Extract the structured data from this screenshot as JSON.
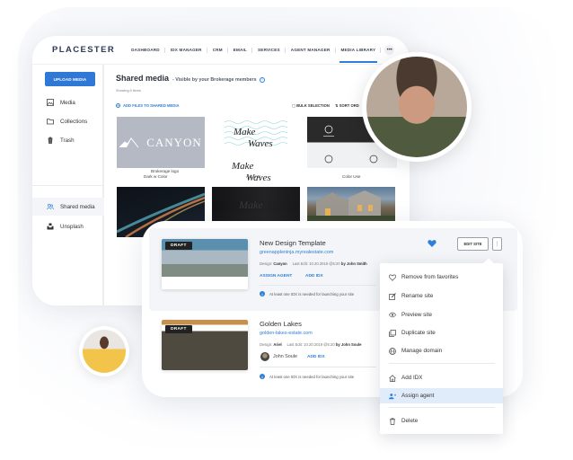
{
  "nav": {
    "brand": "PLACESTER",
    "items": [
      {
        "label": "DASHBOARD"
      },
      {
        "label": "IDX MANAGER"
      },
      {
        "label": "CRM"
      },
      {
        "label": "EMAIL"
      },
      {
        "label": "SERVICES"
      },
      {
        "label": "AGENT MANAGER"
      },
      {
        "label": "MEDIA LIBRARY",
        "active": true
      }
    ],
    "more": "•••"
  },
  "sidebar": {
    "upload_label": "UPLOAD MEDIA",
    "items": [
      {
        "label": "Media",
        "icon": "image-icon"
      },
      {
        "label": "Collections",
        "icon": "folder-icon"
      },
      {
        "label": "Trash",
        "icon": "trash-icon"
      },
      {
        "label": "Shared media",
        "icon": "users-icon",
        "active": true
      },
      {
        "label": "Unsplash",
        "icon": "unsplash-icon"
      }
    ]
  },
  "media": {
    "title": "Shared media",
    "subtitle": "- Visible by your Brokerage members",
    "help": "?",
    "showing": "Showing 6 items",
    "add_files": "ADD FILES TO SHARED MEDIA",
    "bulk": "BULK SELECTION",
    "sort": "SORT ORD",
    "thumbs": [
      {
        "logo_text": "CANYON",
        "caption1": "Brokerage logo",
        "caption2": "Dark w Color"
      },
      {
        "logo_text": "Make Waves",
        "caption": "Accents"
      },
      {
        "caption": "Color Use"
      }
    ]
  },
  "sites": [
    {
      "badge": "DRAFT",
      "name": "New Design Template",
      "url": "greenappleninja.myrealestate.com",
      "design_label": "Design:",
      "design": "Canyon",
      "last_edit_label": "Last Edit: 10.20.2019 @5:20",
      "by": "by John Smith",
      "assign_agent": "ASSIGN AGENT",
      "add_idx": "ADD IDX",
      "notice": "At least one IDX is needed for launching your site",
      "favorite": true,
      "edit_label": "EDIT SITE"
    },
    {
      "badge": "DRAFT",
      "name": "Golden Lakes",
      "url": "golden-lakes-estate.com",
      "design_label": "Design:",
      "design": "Ariel",
      "last_edit_label": "Last Edit: 10.20.2019 @5:20",
      "by": "by John Soule",
      "agent": "John Soule",
      "add_idx": "ADD IDX",
      "notice": "At least one IDX is needed for launching your site"
    }
  ],
  "menu": {
    "items": [
      {
        "label": "Remove from favorites",
        "icon": "heart-outline-icon"
      },
      {
        "label": "Rename site",
        "icon": "edit-icon"
      },
      {
        "label": "Preview site",
        "icon": "eye-icon"
      },
      {
        "label": "Duplicate site",
        "icon": "copy-icon"
      },
      {
        "label": "Manage domain",
        "icon": "globe-icon"
      },
      {
        "label": "Add IDX",
        "icon": "home-icon"
      },
      {
        "label": "Assign agent",
        "icon": "user-plus-icon",
        "highlighted": true
      },
      {
        "label": "Delete",
        "icon": "trash-icon"
      }
    ]
  },
  "colors": {
    "accent": "#2f7fd8",
    "highlight": "#e1ecfb"
  }
}
